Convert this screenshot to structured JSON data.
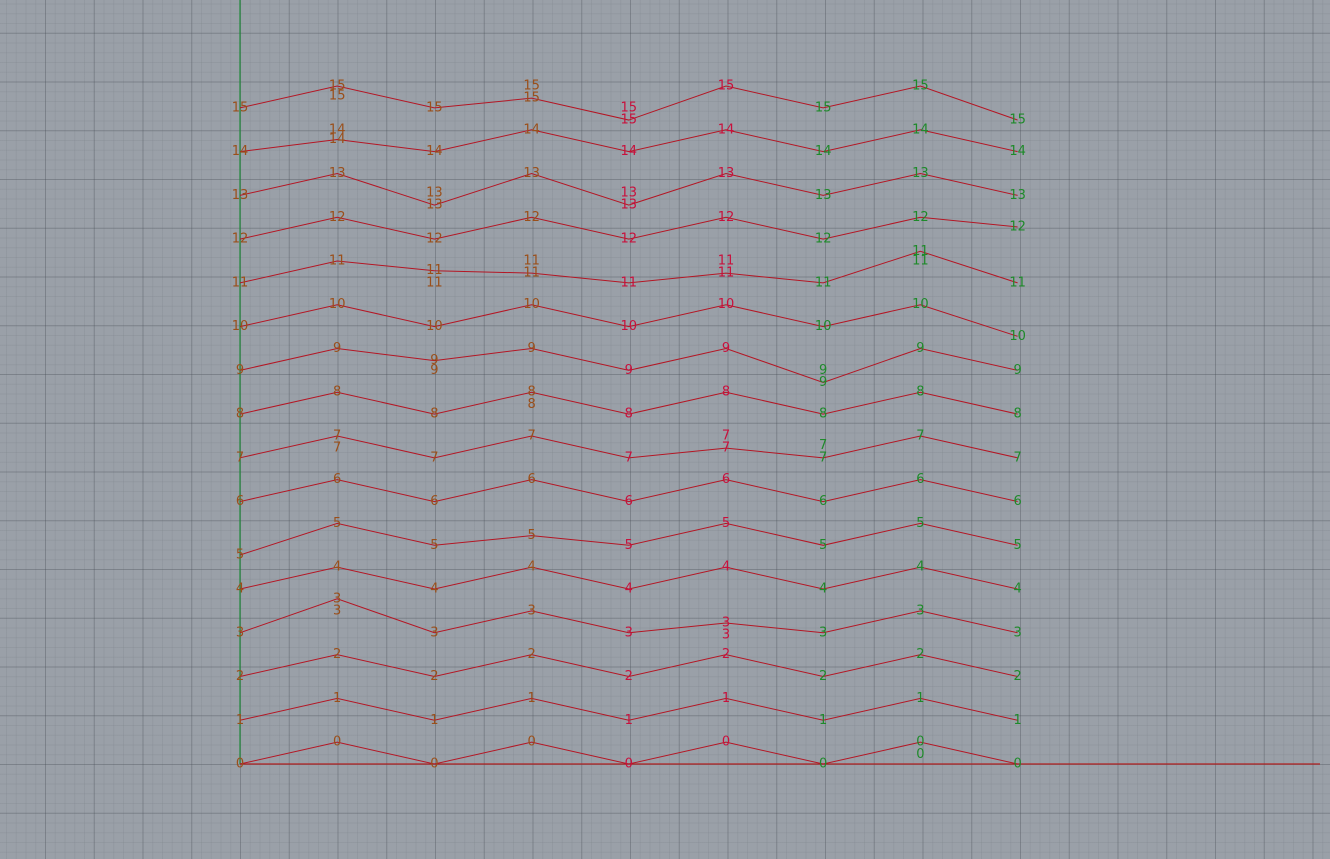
{
  "viewport": {
    "type": "Top"
  },
  "axes": {
    "x_axis_color": "#b02020",
    "y_axis_color": "#1f8a3a"
  },
  "colors": {
    "background": "#9aa0a8",
    "polyline": "#b41624",
    "label_left": "#9a4f1a",
    "label_mid": "#c8103c",
    "label_right": "#1e8a2a"
  },
  "chart_data": {
    "type": "line",
    "x": [
      0,
      2,
      4,
      6,
      8,
      10,
      12,
      14,
      16
    ],
    "point_labels": [
      "0",
      "1",
      "2",
      "3",
      "4",
      "5",
      "6",
      "7",
      "8",
      "9",
      "10",
      "11",
      "12",
      "13",
      "14",
      "15"
    ],
    "series": [
      {
        "label": "0",
        "y": [
          0,
          0.45,
          0,
          0.45,
          0,
          0.45,
          0,
          0.45,
          0
        ],
        "extra": [
          {
            "x": 14,
            "y": 0.2
          }
        ]
      },
      {
        "label": "1",
        "y": [
          0.9,
          1.35,
          0.9,
          1.35,
          0.9,
          1.35,
          0.9,
          1.35,
          0.9
        ]
      },
      {
        "label": "2",
        "y": [
          1.8,
          2.25,
          1.8,
          2.25,
          1.8,
          2.25,
          1.8,
          2.25,
          1.8
        ]
      },
      {
        "label": "3",
        "y": [
          2.7,
          3.4,
          2.7,
          3.15,
          2.7,
          2.9,
          2.7,
          3.15,
          2.7
        ],
        "extra": [
          {
            "x": 2,
            "y": 3.15
          },
          {
            "x": 10,
            "y": 2.65
          }
        ]
      },
      {
        "label": "4",
        "y": [
          3.6,
          4.05,
          3.6,
          4.05,
          3.6,
          4.05,
          3.6,
          4.05,
          3.6
        ]
      },
      {
        "label": "5",
        "y": [
          4.3,
          4.95,
          4.5,
          4.7,
          4.5,
          4.95,
          4.5,
          4.95,
          4.5
        ]
      },
      {
        "label": "6",
        "y": [
          5.4,
          5.85,
          5.4,
          5.85,
          5.4,
          5.85,
          5.4,
          5.85,
          5.4
        ]
      },
      {
        "label": "7",
        "y": [
          6.3,
          6.75,
          6.3,
          6.75,
          6.3,
          6.5,
          6.3,
          6.75,
          6.3
        ],
        "extra": [
          {
            "x": 2,
            "y": 6.5
          },
          {
            "x": 10,
            "y": 6.75
          },
          {
            "x": 12,
            "y": 6.55
          }
        ]
      },
      {
        "label": "8",
        "y": [
          7.2,
          7.65,
          7.2,
          7.65,
          7.2,
          7.65,
          7.2,
          7.65,
          7.2
        ],
        "extra": [
          {
            "x": 6,
            "y": 7.4
          }
        ]
      },
      {
        "label": "9",
        "y": [
          8.1,
          8.55,
          8.3,
          8.55,
          8.1,
          8.55,
          7.85,
          8.55,
          8.1
        ],
        "extra": [
          {
            "x": 4,
            "y": 8.1
          },
          {
            "x": 12,
            "y": 8.1
          }
        ]
      },
      {
        "label": "10",
        "y": [
          9.0,
          9.45,
          9.0,
          9.45,
          9.0,
          9.45,
          9.0,
          9.45,
          8.8
        ]
      },
      {
        "label": "11",
        "y": [
          9.9,
          10.35,
          10.15,
          10.1,
          9.9,
          10.1,
          9.9,
          10.55,
          9.9
        ],
        "extra": [
          {
            "x": 4,
            "y": 9.9
          },
          {
            "x": 6,
            "y": 10.35
          },
          {
            "x": 10,
            "y": 10.35
          },
          {
            "x": 14,
            "y": 10.35
          }
        ]
      },
      {
        "label": "12",
        "y": [
          10.8,
          11.25,
          10.8,
          11.25,
          10.8,
          11.25,
          10.8,
          11.25,
          11.05
        ]
      },
      {
        "label": "13",
        "y": [
          11.7,
          12.15,
          11.5,
          12.15,
          11.5,
          12.15,
          11.7,
          12.15,
          11.7
        ],
        "extra": [
          {
            "x": 4,
            "y": 11.75
          },
          {
            "x": 8,
            "y": 11.75
          }
        ]
      },
      {
        "label": "14",
        "y": [
          12.6,
          12.85,
          12.6,
          13.05,
          12.6,
          13.05,
          12.6,
          13.05,
          12.6
        ],
        "extra": [
          {
            "x": 2,
            "y": 13.05
          }
        ]
      },
      {
        "label": "15",
        "y": [
          13.5,
          13.95,
          13.5,
          13.7,
          13.25,
          13.95,
          13.5,
          13.95,
          13.25
        ],
        "extra": [
          {
            "x": 2,
            "y": 13.75
          },
          {
            "x": 6,
            "y": 13.95
          },
          {
            "x": 8,
            "y": 13.5
          }
        ]
      }
    ]
  }
}
